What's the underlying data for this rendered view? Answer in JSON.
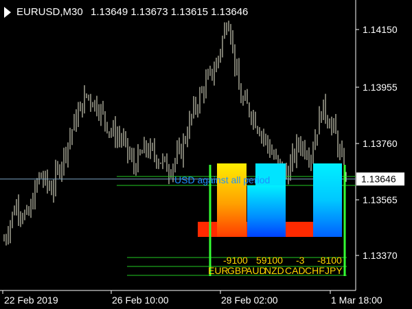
{
  "header": {
    "symbol": "EURUSD,M30",
    "ohlc": "1.13649 1.13673 1.13615 1.13646"
  },
  "price_axis": {
    "ticks": [
      "1.14150",
      "1.13955",
      "1.13760",
      "1.13565",
      "1.13370"
    ],
    "current_price": "1.13646"
  },
  "time_axis": {
    "ticks": [
      "22 Feb 2019",
      "26 Feb 10:00",
      "28 Feb 02:00",
      "1 Mar 18:00"
    ]
  },
  "indicator": {
    "caption": "USD against all period",
    "values": [
      "-9100",
      "59100",
      "-3",
      "-8100"
    ],
    "currency_labels": [
      "EUR",
      "GBP",
      "AUD",
      "NZD",
      "CAD",
      "CHF",
      "JPY"
    ],
    "tall_bar_colors": [
      "#ffd000",
      "#00e0ff",
      "#00e0ff"
    ],
    "base_bar_color": "#ff2a00"
  },
  "colors": {
    "background": "#000000",
    "candles": "#f5f5dc",
    "bid_line": "#7fa7c7",
    "frame": "#33ff33",
    "caption": "#1e90ff",
    "values": "#ffd700",
    "labels": "#ffd700"
  },
  "chart_data": {
    "type": "line",
    "ylim": [
      1.1327,
      1.1425
    ],
    "current_price": 1.13646,
    "x": [
      "22 Feb 2019",
      "26 Feb 10:00",
      "28 Feb 02:00",
      "1 Mar 18:00"
    ],
    "series": [
      {
        "values": [
          1.1344,
          1.1356,
          1.1351,
          1.1366,
          1.1361,
          1.1372,
          1.1384,
          1.1393,
          1.1389,
          1.1381,
          1.1378,
          1.1369,
          1.1375,
          1.1372,
          1.1368,
          1.1374,
          1.1387,
          1.1396,
          1.1403,
          1.142,
          1.1392,
          1.1387,
          1.1379,
          1.1371,
          1.1366,
          1.1377,
          1.1373,
          1.1389,
          1.1381,
          1.1364
        ]
      }
    ]
  }
}
